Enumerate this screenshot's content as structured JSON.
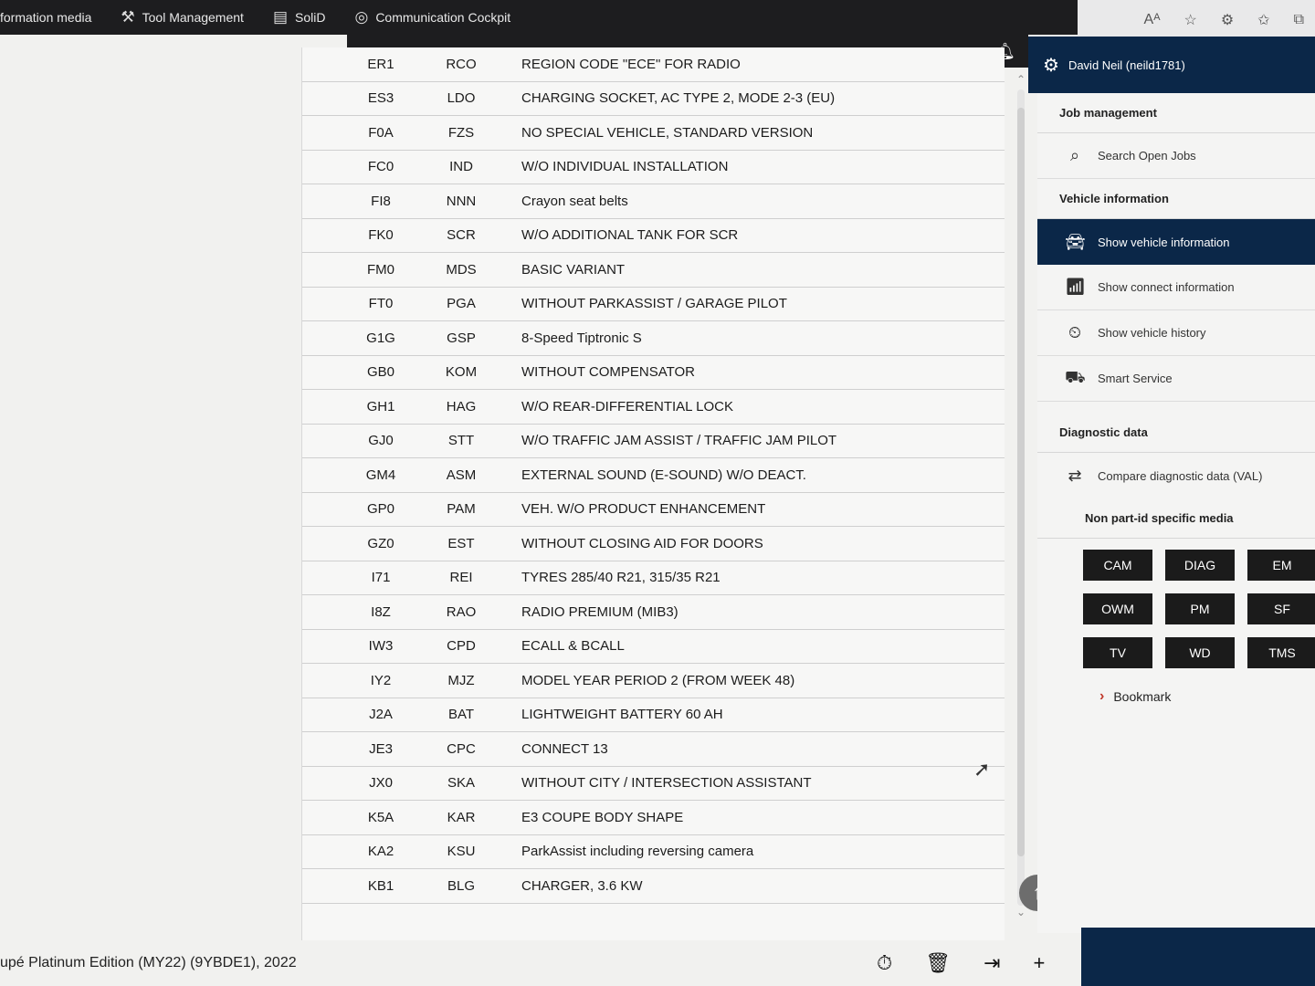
{
  "nav": {
    "items": [
      {
        "label": "formation media",
        "icon": "book-icon"
      },
      {
        "label": "Tool Management",
        "icon": "tools-icon"
      },
      {
        "label": "SoliD",
        "icon": "chat-icon"
      },
      {
        "label": "Communication Cockpit",
        "icon": "cockpit-icon"
      }
    ]
  },
  "user": {
    "name": "David Neil (neild1781)"
  },
  "table": {
    "rows": [
      {
        "code": "ER1",
        "family": "RCO",
        "desc": "REGION CODE \"ECE\" FOR RADIO"
      },
      {
        "code": "ES3",
        "family": "LDO",
        "desc": "CHARGING SOCKET, AC TYPE 2, MODE 2-3 (EU)"
      },
      {
        "code": "F0A",
        "family": "FZS",
        "desc": "NO SPECIAL VEHICLE, STANDARD VERSION"
      },
      {
        "code": "FC0",
        "family": "IND",
        "desc": "W/O INDIVIDUAL INSTALLATION"
      },
      {
        "code": "FI8",
        "family": "NNN",
        "desc": "Crayon seat belts"
      },
      {
        "code": "FK0",
        "family": "SCR",
        "desc": "W/O ADDITIONAL TANK FOR SCR"
      },
      {
        "code": "FM0",
        "family": "MDS",
        "desc": "BASIC VARIANT"
      },
      {
        "code": "FT0",
        "family": "PGA",
        "desc": "WITHOUT PARKASSIST / GARAGE PILOT"
      },
      {
        "code": "G1G",
        "family": "GSP",
        "desc": "8-Speed Tiptronic S"
      },
      {
        "code": "GB0",
        "family": "KOM",
        "desc": "WITHOUT COMPENSATOR"
      },
      {
        "code": "GH1",
        "family": "HAG",
        "desc": "W/O REAR-DIFFERENTIAL LOCK"
      },
      {
        "code": "GJ0",
        "family": "STT",
        "desc": "W/O TRAFFIC JAM ASSIST / TRAFFIC JAM PILOT"
      },
      {
        "code": "GM4",
        "family": "ASM",
        "desc": "EXTERNAL SOUND (E-SOUND) W/O DEACT."
      },
      {
        "code": "GP0",
        "family": "PAM",
        "desc": "VEH. W/O PRODUCT ENHANCEMENT"
      },
      {
        "code": "GZ0",
        "family": "EST",
        "desc": "WITHOUT CLOSING AID FOR DOORS"
      },
      {
        "code": "I71",
        "family": "REI",
        "desc": "TYRES 285/40 R21, 315/35 R21"
      },
      {
        "code": "I8Z",
        "family": "RAO",
        "desc": "RADIO PREMIUM (MIB3)"
      },
      {
        "code": "IW3",
        "family": "CPD",
        "desc": "ECALL & BCALL"
      },
      {
        "code": "IY2",
        "family": "MJZ",
        "desc": "MODEL YEAR PERIOD 2 (FROM WEEK 48)"
      },
      {
        "code": "J2A",
        "family": "BAT",
        "desc": "LIGHTWEIGHT BATTERY 60 AH"
      },
      {
        "code": "JE3",
        "family": "CPC",
        "desc": "CONNECT 13"
      },
      {
        "code": "JX0",
        "family": "SKA",
        "desc": "WITHOUT CITY / INTERSECTION ASSISTANT"
      },
      {
        "code": "K5A",
        "family": "KAR",
        "desc": "E3 COUPE BODY SHAPE"
      },
      {
        "code": "KA2",
        "family": "KSU",
        "desc": "ParkAssist including reversing camera"
      },
      {
        "code": "KB1",
        "family": "BLG",
        "desc": "CHARGER, 3.6 KW"
      }
    ]
  },
  "sidebar": {
    "job_management": {
      "heading": "Job management",
      "items": [
        {
          "label": "Search Open Jobs",
          "icon": "search-icon"
        }
      ]
    },
    "vehicle_information": {
      "heading": "Vehicle information",
      "items": [
        {
          "label": "Show vehicle information",
          "icon": "car-icon",
          "active": true
        },
        {
          "label": "Show connect information",
          "icon": "connect-icon"
        },
        {
          "label": "Show vehicle history",
          "icon": "history-icon"
        },
        {
          "label": "Smart Service",
          "icon": "smart-service-icon"
        }
      ]
    },
    "diagnostic_data": {
      "heading": "Diagnostic data",
      "items": [
        {
          "label": "Compare diagnostic data (VAL)",
          "icon": "compare-icon"
        }
      ]
    },
    "media": {
      "heading": "Non part-id specific media",
      "buttons": [
        "CAM",
        "DIAG",
        "EM",
        "OWM",
        "PM",
        "SF",
        "TV",
        "WD",
        "TMS"
      ]
    },
    "bookmark": "Bookmark"
  },
  "footer": {
    "vehicle": "upé Platinum Edition (MY22) (9YBDE1), 2022"
  },
  "colors": {
    "nav_bg": "#1d1d1f",
    "accent": "#0b2748",
    "media_btn": "#1b1b1b"
  }
}
